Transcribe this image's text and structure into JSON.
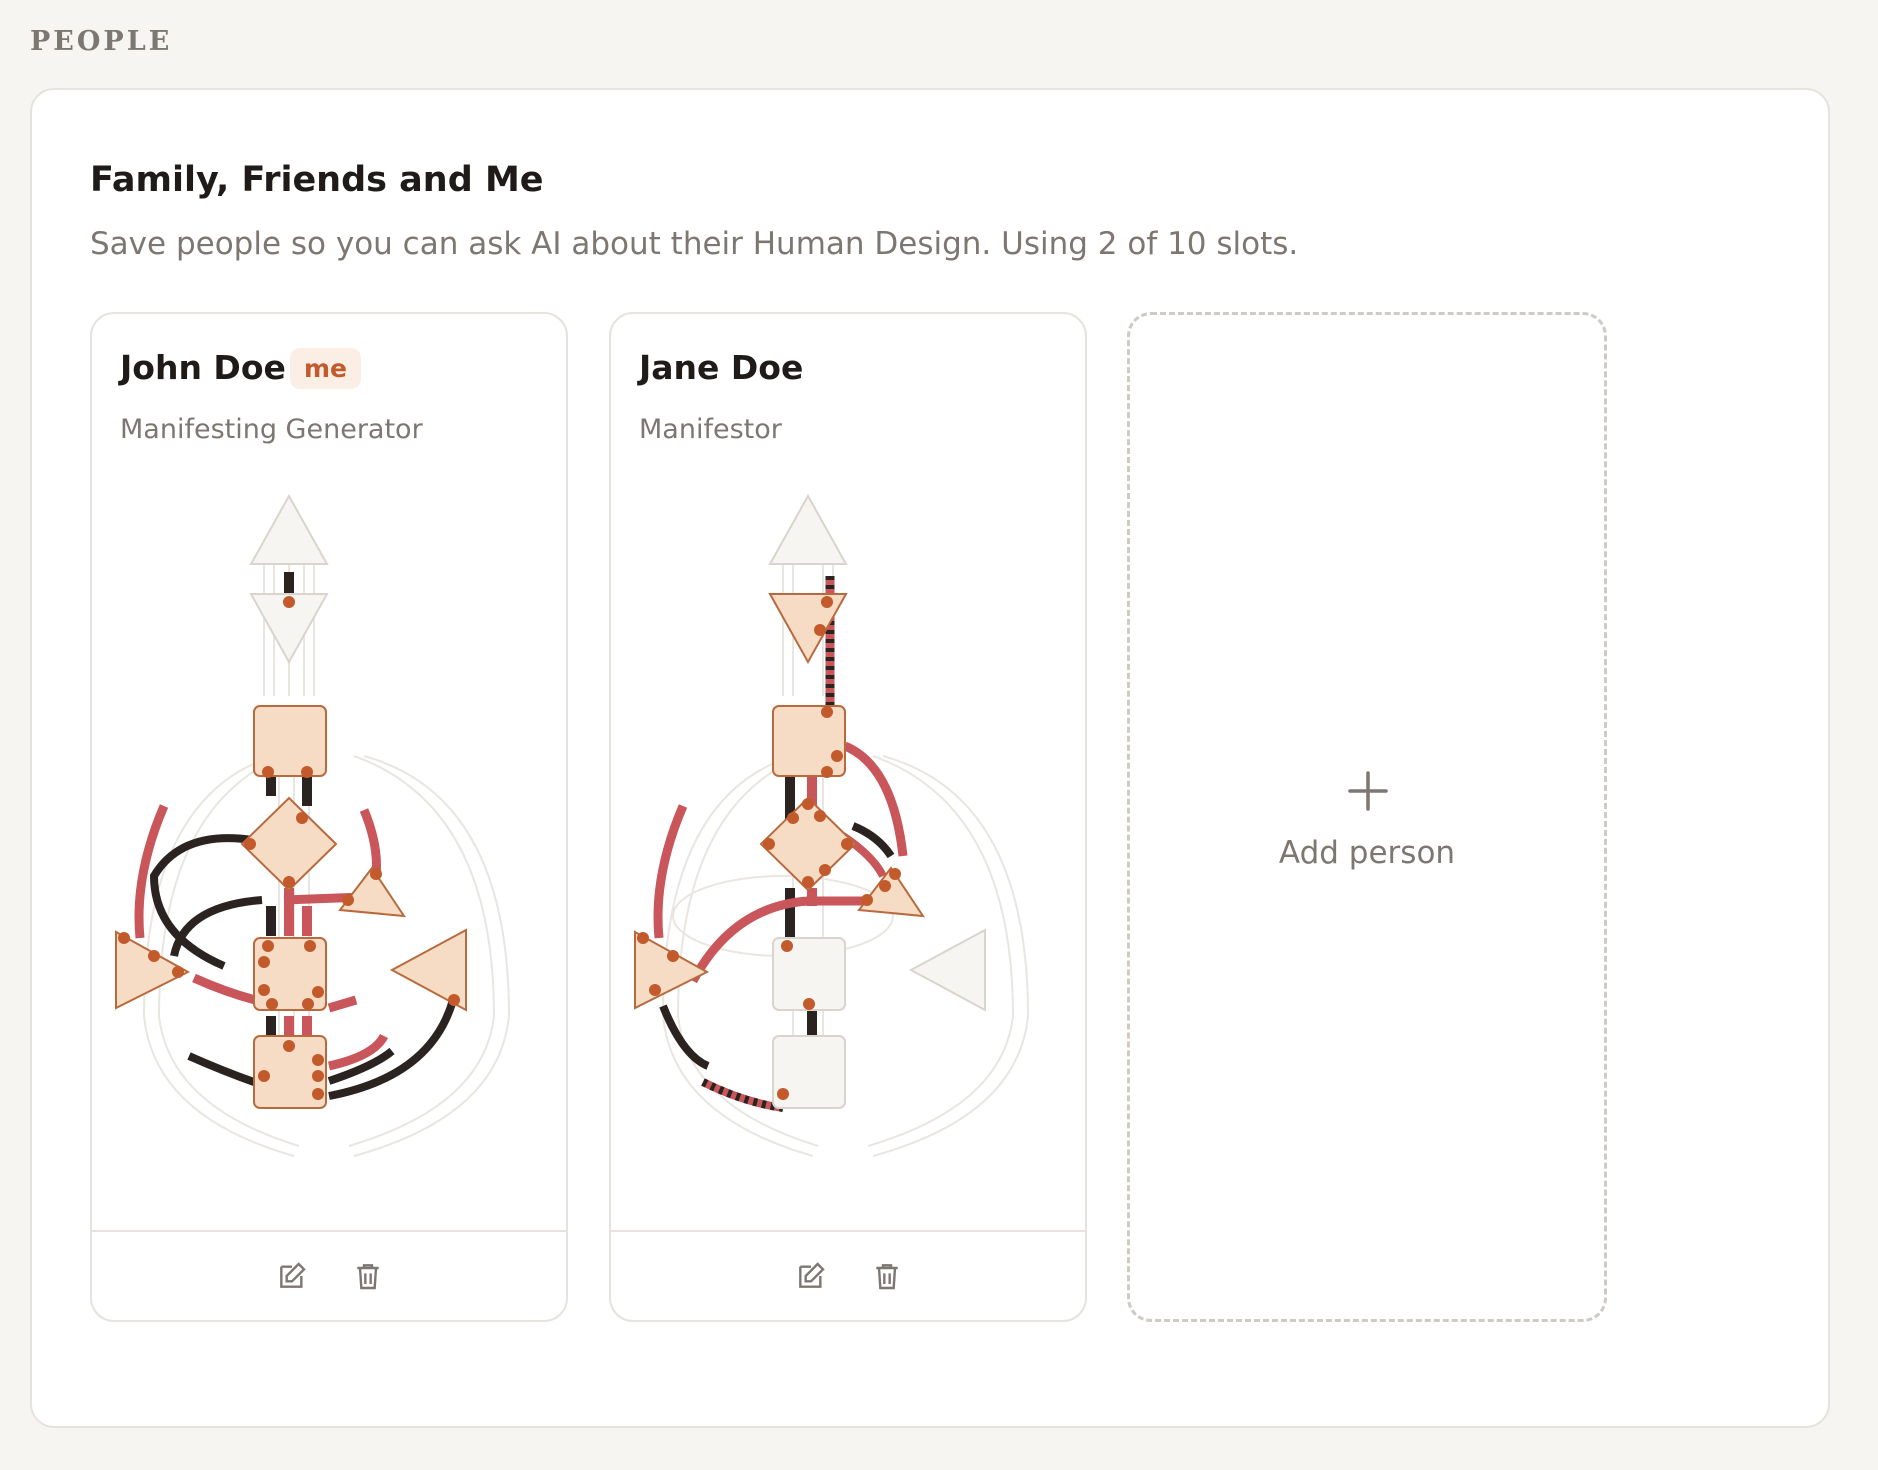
{
  "section": {
    "label": "PEOPLE"
  },
  "panel": {
    "title": "Family, Friends and Me",
    "subtitle": "Save people so you can ask AI about their Human Design. Using 2 of 10 slots."
  },
  "colors": {
    "accent": "#c25a2c",
    "defined_center": "#f6dcc4",
    "channel_red": "#c9565a",
    "channel_black": "#2a2320"
  },
  "people": [
    {
      "name": "John Doe",
      "badge": "me",
      "type": "Manifesting Generator",
      "actions": {
        "edit_icon": "pencil-square-icon",
        "delete_icon": "trash-icon"
      }
    },
    {
      "name": "Jane Doe",
      "badge": "",
      "type": "Manifestor",
      "actions": {
        "edit_icon": "pencil-square-icon",
        "delete_icon": "trash-icon"
      }
    }
  ],
  "add_person": {
    "label": "Add person",
    "icon": "plus-icon"
  }
}
